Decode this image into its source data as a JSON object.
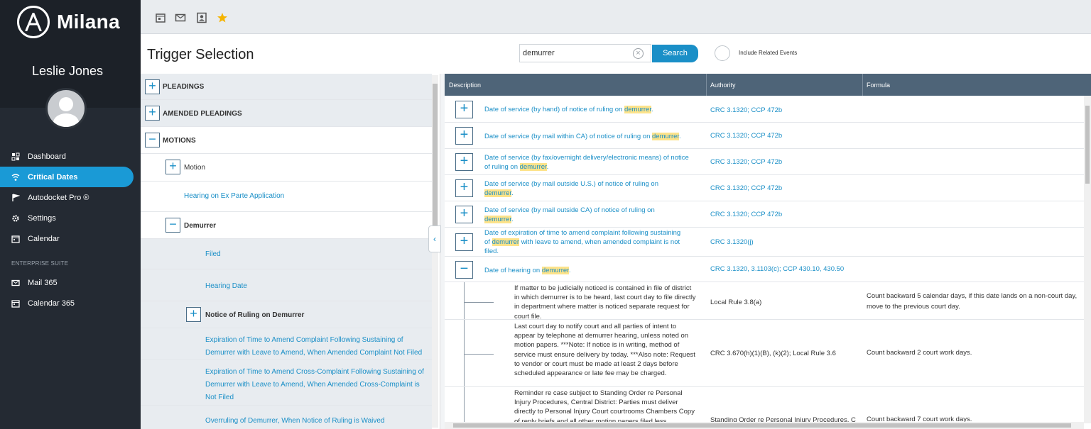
{
  "app": {
    "name": "Milana"
  },
  "user": {
    "name": "Leslie Jones"
  },
  "nav": {
    "items": [
      {
        "label": "Dashboard",
        "icon": "dashboard-icon"
      },
      {
        "label": "Critical Dates",
        "icon": "critical-dates-icon",
        "active": true
      },
      {
        "label": "Autodocket Pro ®",
        "icon": "autodocket-icon"
      },
      {
        "label": "Settings",
        "icon": "gear-icon"
      },
      {
        "label": "Calendar",
        "icon": "calendar-icon"
      }
    ],
    "section_label": "ENTERPRISE SUITE",
    "suite_items": [
      {
        "label": "Mail 365",
        "icon": "mail-icon"
      },
      {
        "label": "Calendar 365",
        "icon": "calendar-icon"
      }
    ]
  },
  "toolbar": {
    "icons": [
      "calendar-icon",
      "mail-icon",
      "contact-icon",
      "star-icon"
    ],
    "star_color": "#f5b400"
  },
  "header": {
    "title": "Trigger Selection",
    "search_value": "demurrer",
    "search_button": "Search",
    "toggle_label": "Include Related Events"
  },
  "tree": {
    "pleadings": "PLEADINGS",
    "amended_pleadings": "AMENDED PLEADINGS",
    "motions": "MOTIONS",
    "motion": "Motion",
    "hearing_ex_parte": "Hearing on Ex Parte Application",
    "demurrer": "Demurrer",
    "filed": "Filed",
    "hearing_date": "Hearing Date",
    "notice_of_ruling": "Notice of Ruling on Demurrer",
    "exp_amend_1": "Expiration of Time to Amend Complaint Following Sustaining of",
    "exp_amend_2": "Demurrer with Leave to Amend, When Amended Complaint Not Filed",
    "exp_cross_1": "Expiration of Time to Amend Cross-Complaint Following Sustaining of",
    "exp_cross_2": "Demurrer with Leave to Amend, When Amended Cross-Complaint is",
    "exp_cross_3": "Not Filed",
    "overruling": "Overruling of Demurrer, When Notice of Ruling is Waived"
  },
  "grid": {
    "columns": {
      "description": "Description",
      "authority": "Authority",
      "formula": "Formula"
    },
    "highlight": "demurrer",
    "rows": [
      {
        "pre": "Date of service (by hand) of notice of ruling on ",
        "post": ".",
        "authority": "CRC 3.1320; CCP 472b"
      },
      {
        "pre": "Date of service (by mail within CA) of notice of ruling on ",
        "post": ".",
        "authority": "CRC 3.1320; CCP 472b"
      },
      {
        "pre": "Date of service (by fax/overnight delivery/electronic means) of notice of ruling on ",
        "post": ".",
        "authority": "CRC 3.1320; CCP 472b"
      },
      {
        "pre": "Date of service (by mail outside U.S.) of notice of ruling on ",
        "post": ".",
        "authority": "CRC 3.1320; CCP 472b"
      },
      {
        "pre": "Date of service (by mail outside CA) of notice of ruling on ",
        "post": ".",
        "authority": "CRC 3.1320; CCP 472b"
      },
      {
        "pre": "Date of expiration of time to amend complaint following sustaining of ",
        "post": " with leave to amend, when amended complaint is not filed.",
        "authority": "CRC 3.1320(j)"
      },
      {
        "pre": "Date of hearing on ",
        "post": ".",
        "authority": "CRC 3.1320, 3.1103(c); CCP 430.10, 430.50"
      }
    ],
    "subrows": [
      {
        "description": "If matter to be judicially noticed is contained in file of district in which demurrer is to be heard, last court day to file directly in department where matter is noticed separate request for court file.",
        "authority": "Local Rule 3.8(a)",
        "formula": "Count backward 5 calendar days, if this date lands on a non-court day, move to the previous court day."
      },
      {
        "description": "Last court day to notify court and all parties of intent to appear by telephone at demurrer hearing, unless noted on motion papers. ***Note: If notice is in writing, method of service must ensure delivery by today. ***Also note: Request to vendor or court must be made at least 2 days before scheduled appearance or late fee may be charged.",
        "authority": "CRC 3.670(h)(1)(B), (k)(2); Local Rule 3.6",
        "formula": "Count backward 2 court work days."
      },
      {
        "description": "Reminder re case subject to Standing Order re Personal Injury Procedures, Central District: Parties must deliver directly to Personal Injury Court courtrooms Chambers Copy of reply briefs and all other motion papers filed less",
        "authority": "Standing Order re Personal Injury Procedures, C",
        "formula": "Count backward 7 court work days."
      }
    ]
  }
}
